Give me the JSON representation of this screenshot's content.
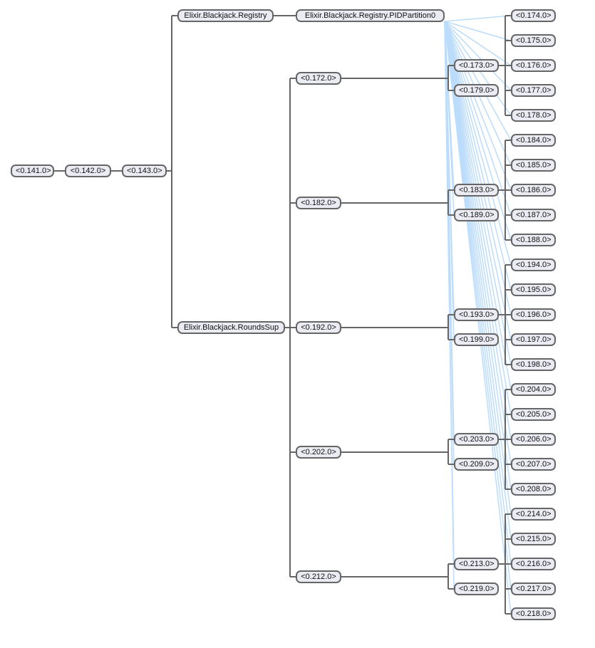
{
  "colors": {
    "edge": "#666666",
    "link": "#bcdcfb",
    "node_fill": "#ebebf3",
    "node_border": "#666666"
  },
  "tree": {
    "root": "<0.141.0>",
    "level1": "<0.142.0>",
    "level2": "<0.143.0>",
    "registry": "Elixir.Blackjack.Registry",
    "partition": "Elixir.Blackjack.Registry.PIDPartition0",
    "rounds_sup": "Elixir.Blackjack.RoundsSup",
    "groups": [
      {
        "pid": "<0.172.0>",
        "children": [
          {
            "pid": "<0.173.0>",
            "children": [
              "<0.174.0>",
              "<0.175.0>",
              "<0.176.0>",
              "<0.177.0>",
              "<0.178.0>"
            ]
          },
          {
            "pid": "<0.179.0>",
            "children": []
          }
        ]
      },
      {
        "pid": "<0.182.0>",
        "children": [
          {
            "pid": "<0.183.0>",
            "children": [
              "<0.184.0>",
              "<0.185.0>",
              "<0.186.0>",
              "<0.187.0>",
              "<0.188.0>"
            ]
          },
          {
            "pid": "<0.189.0>",
            "children": []
          }
        ]
      },
      {
        "pid": "<0.192.0>",
        "children": [
          {
            "pid": "<0.193.0>",
            "children": [
              "<0.194.0>",
              "<0.195.0>",
              "<0.196.0>",
              "<0.197.0>",
              "<0.198.0>"
            ]
          },
          {
            "pid": "<0.199.0>",
            "children": []
          }
        ]
      },
      {
        "pid": "<0.202.0>",
        "children": [
          {
            "pid": "<0.203.0>",
            "children": [
              "<0.204.0>",
              "<0.205.0>",
              "<0.206.0>",
              "<0.207.0>",
              "<0.208.0>"
            ]
          },
          {
            "pid": "<0.209.0>",
            "children": []
          }
        ]
      },
      {
        "pid": "<0.212.0>",
        "children": [
          {
            "pid": "<0.213.0>",
            "children": [
              "<0.214.0>",
              "<0.215.0>",
              "<0.216.0>",
              "<0.217.0>",
              "<0.218.0>"
            ]
          },
          {
            "pid": "<0.219.0>",
            "children": []
          }
        ]
      }
    ]
  }
}
